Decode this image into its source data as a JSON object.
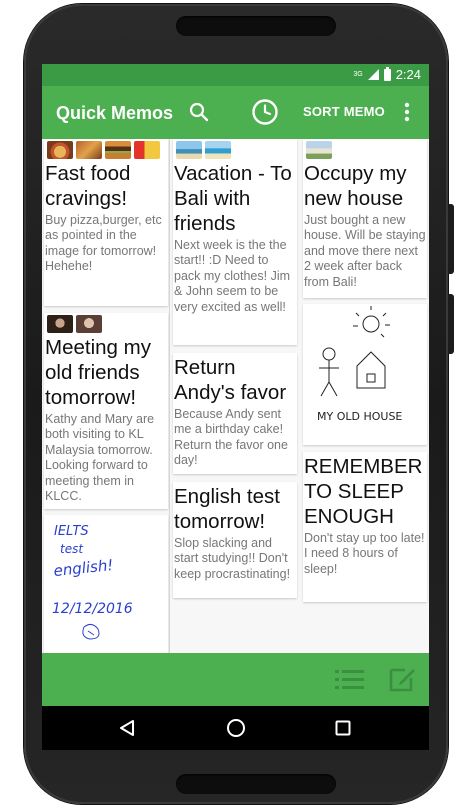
{
  "status_bar": {
    "network": "3G",
    "time": "2:24"
  },
  "app_bar": {
    "title": "Quick Memos",
    "sort_label": "SORT MEMO",
    "icons": [
      "search-icon",
      "clock-icon",
      "more-vert-icon"
    ]
  },
  "memos": {
    "col1": [
      {
        "title": "Fast food cravings!",
        "body": "Buy pizza,burger, etc as pointed in the image for tomorrow! Hehehe!",
        "images": [
          "pizza",
          "food",
          "burger",
          "fries"
        ]
      },
      {
        "title": "Meeting my old friends tomorrow!",
        "body": "Kathy and Mary are both visiting to KL Malaysia tomorrow. Looking forward to meeting them in KLCC.",
        "images": [
          "friend-photo-1",
          "friend-photo-2"
        ]
      },
      {
        "title": "",
        "body": "",
        "sketch_text": [
          "IELTS",
          "test",
          "english!",
          "12/12/2016"
        ]
      }
    ],
    "col2": [
      {
        "title": "Vacation - To Bali with friends",
        "body": "Next week is the the start!! :D Need to pack my clothes! Jim & John seem to be very excited as well!",
        "images": [
          "beach-1",
          "beach-2"
        ]
      },
      {
        "title": "Return Andy's favor",
        "body": "Because Andy sent me a birthday cake! Return the favor one day!"
      },
      {
        "title": "English test tomorrow!",
        "body": "Slop slacking and start studying!! Don't keep procrastinating!"
      }
    ],
    "col3": [
      {
        "title": "Occupy my new house",
        "body": "Just bought a new house. Will be staying and move there next 2 week after back from Bali!",
        "images": [
          "house-photo"
        ]
      },
      {
        "title": "",
        "body": "",
        "sketch_text": [
          "MY OLD HOUSE"
        ]
      },
      {
        "title": "REMEMBER TO SLEEP ENOUGH",
        "body": "Don't stay up too late! I need 8 hours of sleep!"
      }
    ]
  },
  "bottom_bar": {
    "icons": [
      "list-icon",
      "compose-icon"
    ]
  },
  "nav_bar": {
    "icons": [
      "back-icon",
      "home-icon",
      "recents-icon"
    ]
  },
  "colors": {
    "status_bar": "#3b9a44",
    "app_bar": "#4caf50",
    "bottom_bar": "#4caf50",
    "nav_bar": "#000000",
    "sketch_ink": "#2a3fd0"
  }
}
